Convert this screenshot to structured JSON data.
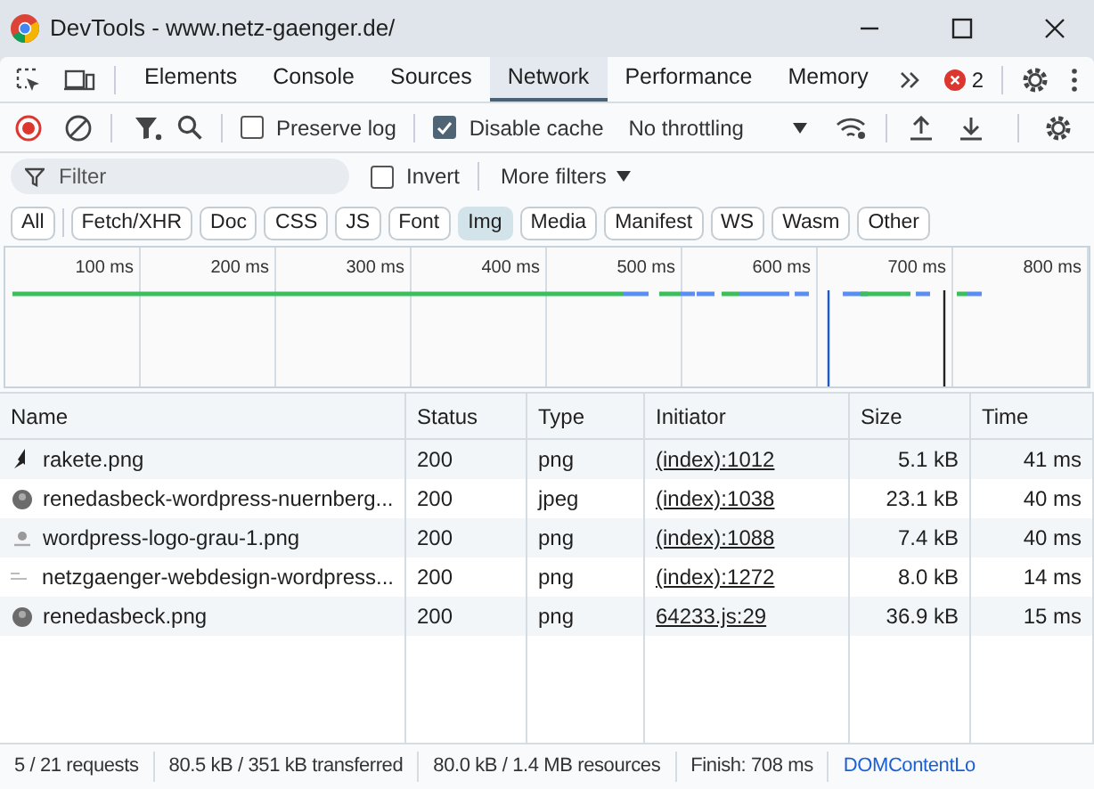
{
  "window": {
    "title": "DevTools - www.netz-gaenger.de/"
  },
  "tabs": [
    {
      "label": "Elements",
      "selected": false
    },
    {
      "label": "Console",
      "selected": false
    },
    {
      "label": "Sources",
      "selected": false
    },
    {
      "label": "Network",
      "selected": true
    },
    {
      "label": "Performance",
      "selected": false
    },
    {
      "label": "Memory",
      "selected": false
    }
  ],
  "error_count": "2",
  "toolbar": {
    "preserve_log": {
      "label": "Preserve log",
      "checked": false
    },
    "disable_cache": {
      "label": "Disable cache",
      "checked": true
    },
    "throttling": "No throttling"
  },
  "filter": {
    "placeholder": "Filter",
    "invert": {
      "label": "Invert",
      "checked": false
    },
    "more_filters": "More filters"
  },
  "type_filters": [
    {
      "label": "All",
      "selected": false
    },
    {
      "label": "Fetch/XHR",
      "selected": false
    },
    {
      "label": "Doc",
      "selected": false
    },
    {
      "label": "CSS",
      "selected": false
    },
    {
      "label": "JS",
      "selected": false
    },
    {
      "label": "Font",
      "selected": false
    },
    {
      "label": "Img",
      "selected": true
    },
    {
      "label": "Media",
      "selected": false
    },
    {
      "label": "Manifest",
      "selected": false
    },
    {
      "label": "WS",
      "selected": false
    },
    {
      "label": "Wasm",
      "selected": false
    },
    {
      "label": "Other",
      "selected": false
    }
  ],
  "timeline": {
    "ticks": [
      "100 ms",
      "200 ms",
      "300 ms",
      "400 ms",
      "500 ms",
      "600 ms",
      "700 ms",
      "800 ms"
    ]
  },
  "table": {
    "columns": [
      "Name",
      "Status",
      "Type",
      "Initiator",
      "Size",
      "Time"
    ],
    "rows": [
      {
        "kind": "rocket",
        "name": "rakete.png",
        "status": "200",
        "type": "png",
        "initiator": "(index):1012",
        "size": "5.1 kB",
        "time": "41 ms"
      },
      {
        "kind": "avatar",
        "name": "renedasbeck-wordpress-nuernberg...",
        "status": "200",
        "type": "jpeg",
        "initiator": "(index):1038",
        "size": "23.1 kB",
        "time": "40 ms"
      },
      {
        "kind": "logo",
        "name": "wordpress-logo-grau-1.png",
        "status": "200",
        "type": "png",
        "initiator": "(index):1088",
        "size": "7.4 kB",
        "time": "40 ms"
      },
      {
        "kind": "thumbnail",
        "name": "netzgaenger-webdesign-wordpress...",
        "status": "200",
        "type": "png",
        "initiator": "(index):1272",
        "size": "8.0 kB",
        "time": "14 ms"
      },
      {
        "kind": "avatar",
        "name": "renedasbeck.png",
        "status": "200",
        "type": "png",
        "initiator": "64233.js:29",
        "size": "36.9 kB",
        "time": "15 ms"
      }
    ]
  },
  "status_bar": [
    {
      "text": "5 / 21 requests",
      "kind": "plain"
    },
    {
      "text": "80.5 kB / 351 kB transferred",
      "kind": "plain"
    },
    {
      "text": "80.0 kB / 1.4 MB resources",
      "kind": "plain"
    },
    {
      "text": "Finish: 708 ms",
      "kind": "plain"
    },
    {
      "text": "DOMContentLo",
      "kind": "event"
    }
  ]
}
